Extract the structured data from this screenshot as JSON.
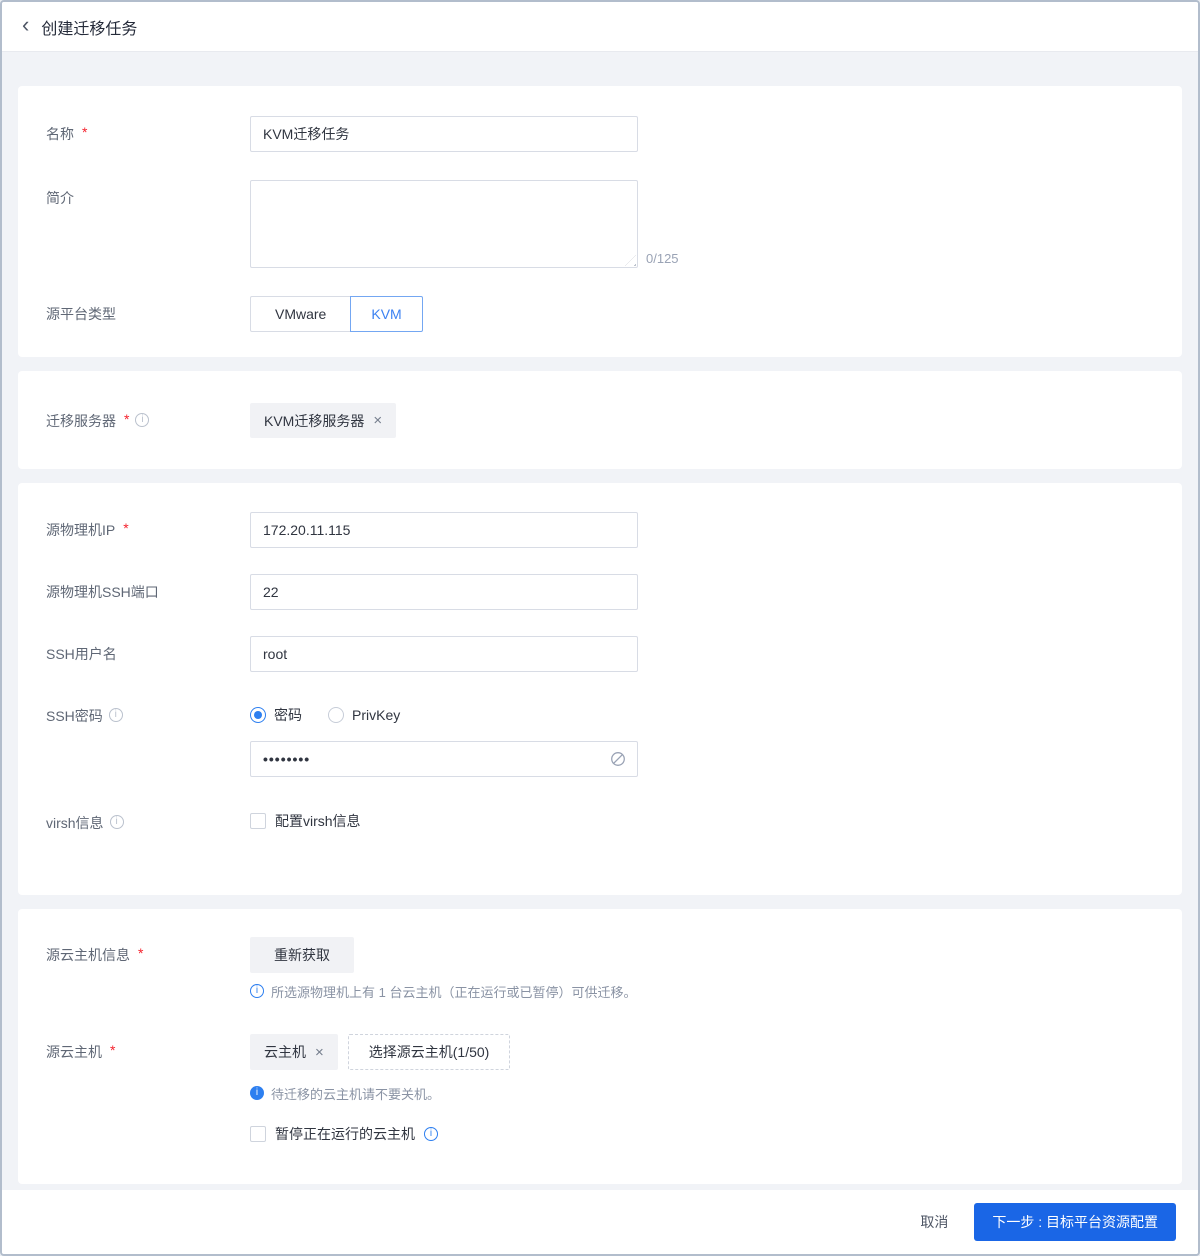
{
  "window": {
    "title": "创建迁移任务",
    "back_icon": "‹"
  },
  "icons": {
    "info": "i",
    "close": "×"
  },
  "colors": {
    "accent": "#1a66e6",
    "info_blue": "#2d7ff0"
  },
  "required_mark": "*",
  "basic": {
    "name_label": "名称",
    "name_value": "KVM迁移任务",
    "desc_label": "简介",
    "desc_value": "",
    "desc_counter": "0/125",
    "platform_label": "源平台类型",
    "platform_options": [
      "VMware",
      "KVM"
    ],
    "platform_selected": "KVM"
  },
  "server": {
    "label": "迁移服务器",
    "tag": "KVM迁移服务器"
  },
  "ssh": {
    "ip_label": "源物理机IP",
    "ip_value": "172.20.11.115",
    "port_label": "源物理机SSH端口",
    "port_value": "22",
    "user_label": "SSH用户名",
    "user_value": "root",
    "password_label": "SSH密码",
    "password_modes": [
      "密码",
      "PrivKey"
    ],
    "password_mode_selected": "密码",
    "password_value": "••••••••",
    "virsh_label": "virsh信息",
    "virsh_checkbox_label": "配置virsh信息",
    "virsh_checked": false
  },
  "source": {
    "info_label": "源云主机信息",
    "refresh_button": "重新获取",
    "info_hint": "所选源物理机上有 1 台云主机（正在运行或已暂停）可供迁移。",
    "vm_label": "源云主机",
    "vm_tag": "云主机",
    "select_button": "选择源云主机(1/50)",
    "vm_hint": "待迁移的云主机请不要关机。",
    "pause_checkbox_label": "暂停正在运行的云主机",
    "pause_checked": false
  },
  "footer": {
    "cancel": "取消",
    "next": "下一步 : 目标平台资源配置"
  }
}
